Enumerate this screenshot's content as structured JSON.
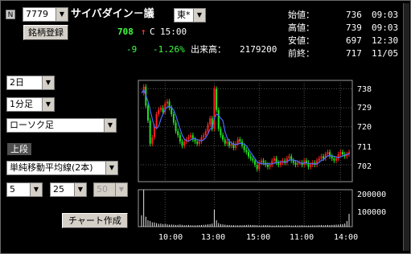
{
  "header": {
    "badge": "N",
    "code_select": "7779",
    "company_name": "サイバダイン－議",
    "market_select": "東*",
    "register_button": "銘柄登録"
  },
  "quote": {
    "price": "708",
    "arrow": "↑",
    "flag": "C",
    "time": "15:00",
    "change": "-9",
    "change_pct": "-1.26%",
    "volume_label": "出来高：",
    "volume": "2179200"
  },
  "stats": [
    {
      "label": "始値：",
      "value": "736",
      "time": "09:03"
    },
    {
      "label": "高値：",
      "value": "739",
      "time": "09:03"
    },
    {
      "label": "安値：",
      "value": "697",
      "time": "12:30"
    },
    {
      "label": "前終：",
      "value": "717",
      "time": "11/05"
    }
  ],
  "controls": {
    "period_select": "2日",
    "interval_select": "1分足",
    "chart_type_select": "ローソク足",
    "section_label": "上段",
    "indicator_select": "単純移動平均線(2本)",
    "ma1_select": "5",
    "ma2_select": "25",
    "ma3_select": "50",
    "draw_button": "チャート作成"
  },
  "colors": {
    "background": "#000000",
    "price_up": "#ff3030",
    "price_green": "#40ff40",
    "candle_up": "#ff2020",
    "candle_down": "#20e020",
    "ma": "#4a6cff",
    "volume": "#e8e8e8"
  },
  "chart_data": {
    "type": "candlestick",
    "price_ticks": [
      "738",
      "729",
      "720",
      "711",
      "702"
    ],
    "price_tick_values": [
      738,
      729,
      720,
      711,
      702
    ],
    "volume_ticks": [
      "200000",
      "100000"
    ],
    "volume_tick_values": [
      200000,
      100000
    ],
    "x_ticks": [
      "10:00",
      "13:00",
      "15:00",
      "11:00",
      "14:00"
    ],
    "ylim": [
      694,
      742
    ],
    "volume_ylim": [
      0,
      260000
    ],
    "grid": true,
    "price_path": [
      736,
      739,
      730,
      723,
      712,
      715,
      720,
      726,
      728,
      729,
      727,
      731,
      732,
      729,
      726,
      722,
      718,
      716,
      713,
      711,
      713,
      714,
      715,
      716,
      714,
      713,
      712,
      713,
      715,
      716,
      718,
      721,
      724,
      719,
      738,
      728,
      719,
      716,
      714,
      712,
      713,
      711,
      712,
      710,
      712,
      714,
      713,
      711,
      709,
      708,
      706,
      705,
      704,
      702,
      700,
      703,
      704,
      703,
      702,
      701,
      702,
      704,
      705,
      703,
      702,
      703,
      704,
      703,
      705,
      706,
      704,
      703,
      702,
      703,
      703,
      702,
      704,
      703,
      701,
      702,
      703,
      702,
      704,
      705,
      706,
      705,
      707,
      708,
      706,
      705,
      704,
      705,
      707,
      708,
      707,
      706,
      707,
      708
    ],
    "volume_path": [
      80000,
      260000,
      70000,
      45000,
      40000,
      30000,
      30000,
      25000,
      20000,
      22000,
      18000,
      20000,
      16000,
      14000,
      15000,
      14000,
      12000,
      13000,
      15000,
      12000,
      10000,
      11000,
      12000,
      10000,
      9000,
      9000,
      10000,
      11000,
      12000,
      13000,
      14000,
      16000,
      18000,
      22000,
      120000,
      45000,
      25000,
      18000,
      16000,
      14000,
      12000,
      12000,
      10000,
      11000,
      9000,
      9000,
      10000,
      10000,
      11000,
      12000,
      13000,
      12000,
      12000,
      11000,
      10000,
      9000,
      9000,
      10000,
      11000,
      10000,
      9000,
      8000,
      8000,
      9000,
      10000,
      9000,
      8000,
      9000,
      10000,
      9000,
      8000,
      8000,
      9000,
      8000,
      9000,
      10000,
      9000,
      8000,
      8000,
      9000,
      10000,
      9000,
      10000,
      11000,
      12000,
      10000,
      11000,
      12000,
      11000,
      12000,
      13000,
      14000,
      15000,
      16000,
      18000,
      22000,
      40000,
      90000
    ]
  }
}
